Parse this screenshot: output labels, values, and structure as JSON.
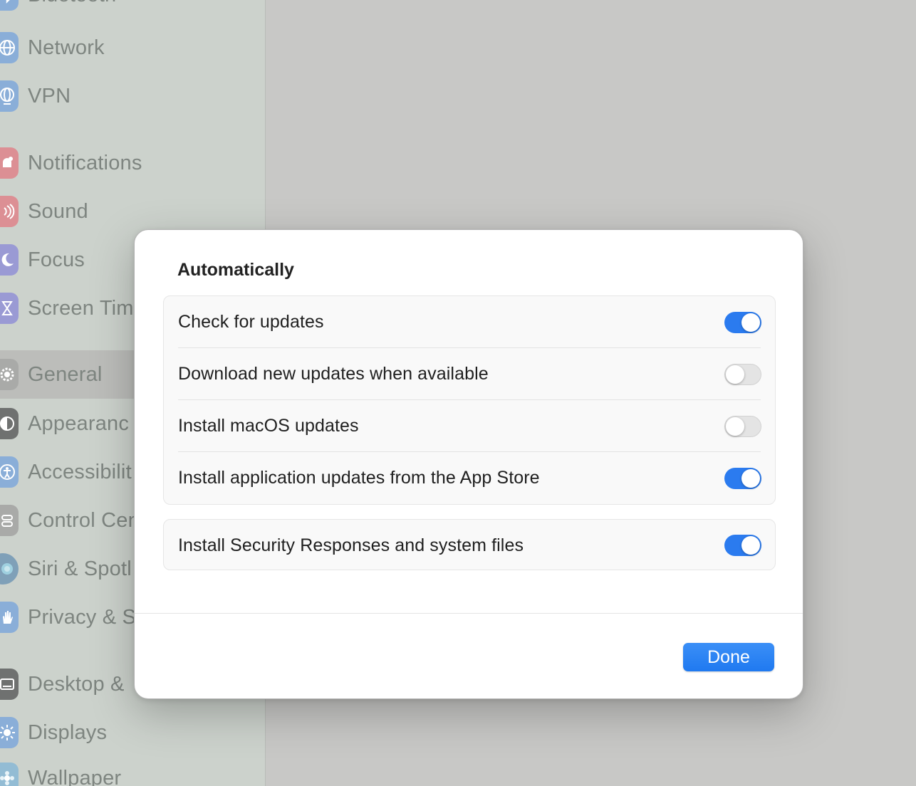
{
  "sidebar": {
    "items": [
      {
        "label": "Bluetooth",
        "icon": "bluetooth-icon",
        "color": "#8aaed8"
      },
      {
        "label": "Network",
        "icon": "globe-icon",
        "color": "#8aaed8"
      },
      {
        "label": "VPN",
        "icon": "vpn-globe-icon",
        "color": "#8aaed8"
      },
      {
        "label": "Notifications",
        "icon": "bell-icon",
        "color": "#dc8f94"
      },
      {
        "label": "Sound",
        "icon": "speaker-icon",
        "color": "#dc8f94"
      },
      {
        "label": "Focus",
        "icon": "moon-icon",
        "color": "#9a9ad4"
      },
      {
        "label": "Screen Tim",
        "icon": "hourglass-icon",
        "color": "#9a9ad4"
      },
      {
        "label": "General",
        "icon": "gear-icon",
        "color": "#a9aaa8"
      },
      {
        "label": "Appearanc",
        "icon": "appearance-icon",
        "color": "#6f7170"
      },
      {
        "label": "Accessibilit",
        "icon": "accessibility-icon",
        "color": "#8aaed8"
      },
      {
        "label": "Control Cen",
        "icon": "control-center-icon",
        "color": "#a9aaa8"
      },
      {
        "label": "Siri & Spotl",
        "icon": "siri-icon",
        "color": "#7fa0b8"
      },
      {
        "label": "Privacy & S",
        "icon": "hand-icon",
        "color": "#8aaed8"
      },
      {
        "label": "Desktop & ",
        "icon": "desktop-icon",
        "color": "#6f7170"
      },
      {
        "label": "Displays",
        "icon": "sun-icon",
        "color": "#8aaed8"
      },
      {
        "label": "Wallpaper",
        "icon": "wallpaper-icon",
        "color": "#93bcd4"
      }
    ]
  },
  "modal": {
    "section_title": "Automatically",
    "group1": [
      {
        "label": "Check for updates",
        "on": true
      },
      {
        "label": "Download new updates when available",
        "on": false
      },
      {
        "label": "Install macOS updates",
        "on": false
      },
      {
        "label": "Install application updates from the App Store",
        "on": true
      }
    ],
    "group2": [
      {
        "label": "Install Security Responses and system files",
        "on": true
      }
    ],
    "done_label": "Done"
  },
  "colors": {
    "accent": "#2b7bef",
    "toggle_off": "#e4e4e4"
  }
}
